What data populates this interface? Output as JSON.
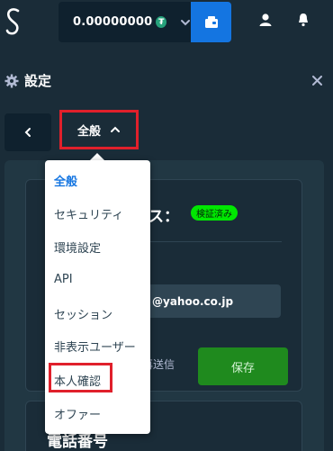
{
  "topbar": {
    "balance": "0.00000000",
    "coin_symbol": "₮",
    "colors": {
      "wallet_button": "#1475e1",
      "coin": "#26a17b"
    }
  },
  "settings": {
    "title": "設定",
    "current_tab": "全般"
  },
  "dropdown": {
    "items": [
      {
        "label": "全般",
        "active": true
      },
      {
        "label": "セキュリティ",
        "active": false
      },
      {
        "label": "環境設定",
        "active": false
      },
      {
        "label": "API",
        "active": false
      },
      {
        "label": "セッション",
        "active": false
      },
      {
        "label": "非表示ユーザー",
        "active": false
      },
      {
        "label": "本人確認",
        "active": false,
        "highlighted": true
      },
      {
        "label": "オファー",
        "active": false
      }
    ]
  },
  "email_section": {
    "status_label": "ス：",
    "badge": "検証済み",
    "email_value": "@yahoo.co.jp",
    "resend_label": "再送信",
    "save_label": "保存"
  },
  "phone_section": {
    "title": "電話番号"
  },
  "colors": {
    "highlight_border": "#e0202b",
    "verified_badge": "#00e701",
    "save_button": "#1f8a1e",
    "active_item": "#1475e1"
  }
}
